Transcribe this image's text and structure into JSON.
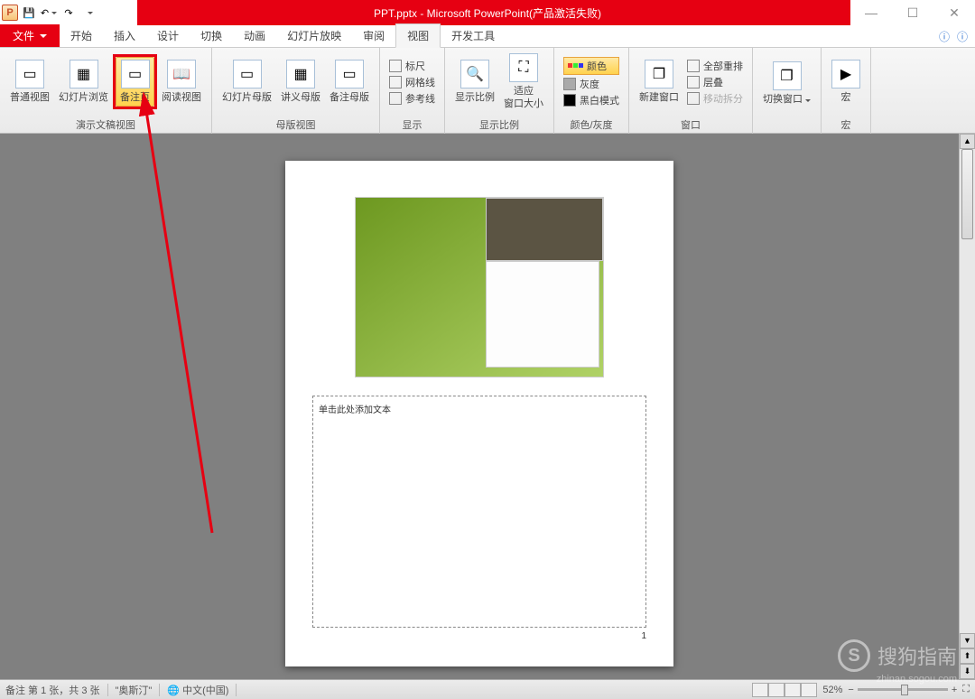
{
  "title": "PPT.pptx - Microsoft PowerPoint(产品激活失败)",
  "qa_toolbar": {
    "save": "💾",
    "undo": "↶",
    "redo": "↷",
    "print": "🖶"
  },
  "win": {
    "min": "—",
    "max": "☐",
    "close": "✕"
  },
  "menu": {
    "file": "文件",
    "tabs": [
      "开始",
      "插入",
      "设计",
      "切换",
      "动画",
      "幻灯片放映",
      "审阅",
      "视图",
      "开发工具"
    ],
    "active": "视图"
  },
  "ribbon": {
    "g1": {
      "label": "演示文稿视图",
      "btns": {
        "normal": "普通视图",
        "sorter": "幻灯片浏览",
        "notes": "备注页",
        "reading": "阅读视图"
      }
    },
    "g2": {
      "label": "母版视图",
      "btns": {
        "slide": "幻灯片母版",
        "handout": "讲义母版",
        "notes": "备注母版"
      }
    },
    "g3": {
      "label": "显示",
      "items": {
        "ruler": "标尺",
        "grid": "网格线",
        "guide": "参考线"
      }
    },
    "g4": {
      "label": "显示比例",
      "btns": {
        "zoom": "显示比例",
        "fit": "适应\n窗口大小"
      }
    },
    "g5": {
      "label": "颜色/灰度",
      "items": {
        "color": "颜色",
        "gray": "灰度",
        "bw": "黑白模式"
      }
    },
    "g6": {
      "label": "窗口",
      "btn": "新建窗口",
      "items": {
        "arrange": "全部重排",
        "cascade": "层叠",
        "split": "移动拆分"
      }
    },
    "g7": {
      "label": "",
      "btn": "切换窗口"
    },
    "g8": {
      "label": "宏",
      "btn": "宏"
    }
  },
  "notes": {
    "placeholder": "单击此处添加文本",
    "pagenum": "1"
  },
  "status": {
    "left1": "备注 第 1 张，共 3 张",
    "theme": "\"奥斯汀\"",
    "lang": "中文(中国)",
    "zoom": "52%"
  },
  "watermark": {
    "logo": "S",
    "text": "搜狗指南",
    "url": "zhinan.sogou.com"
  }
}
